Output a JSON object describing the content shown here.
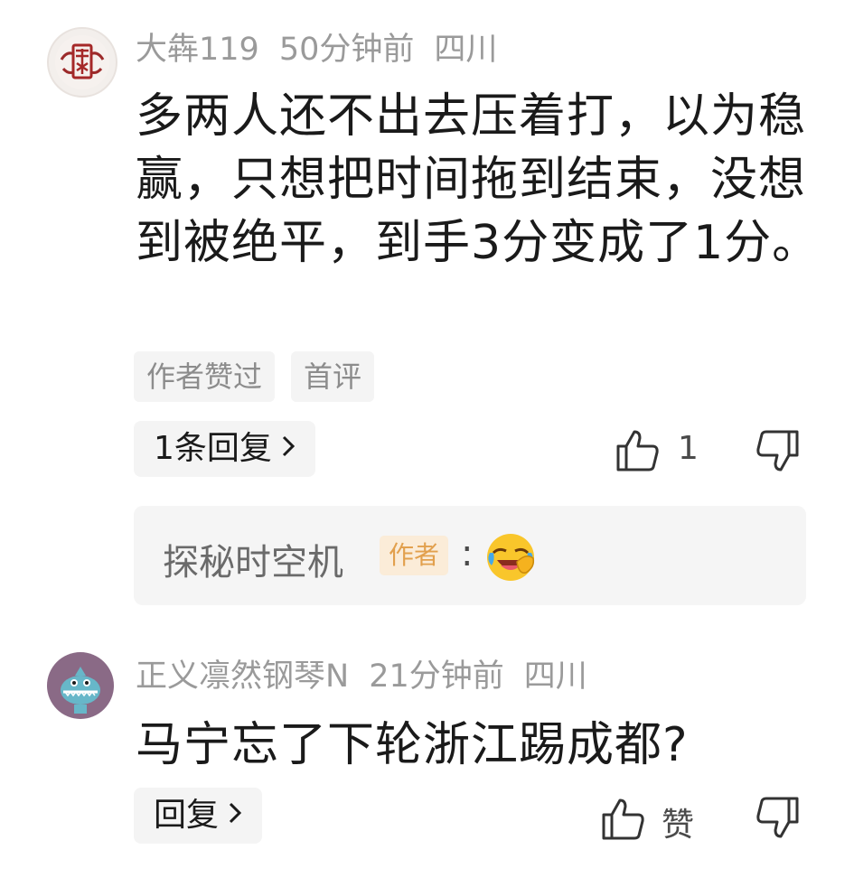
{
  "comments": [
    {
      "username": "大犇119",
      "time": "50分钟前",
      "location": "四川",
      "text": "多两人还不出去压着打，以为稳赢，只想把时间拖到结束，没想到被绝平，到手3分变成了1分。",
      "tags": [
        "作者赞过",
        "首评"
      ],
      "reply_button": "1条回复",
      "like_count": "1",
      "reply_preview": {
        "author": "探秘时空机",
        "badge": "作者",
        "separator": ":",
        "emoji": "😂"
      }
    },
    {
      "username": "正义凛然钢琴N",
      "time": "21分钟前",
      "location": "四川",
      "text": "马宁忘了下轮浙江踢成都?",
      "reply_button": "回复",
      "like_label": "赞"
    }
  ],
  "colors": {
    "meta": "#9a9a9a",
    "tag_bg": "#f4f4f4",
    "badge_bg": "#fbecd8",
    "badge_text": "#e2a04d",
    "avatar2_bg": "#8a6a86"
  },
  "icons": [
    "avatar-seal-icon",
    "thumbs-up-icon",
    "thumbs-down-icon",
    "laughing-emoji-icon",
    "avatar-shark-icon"
  ]
}
